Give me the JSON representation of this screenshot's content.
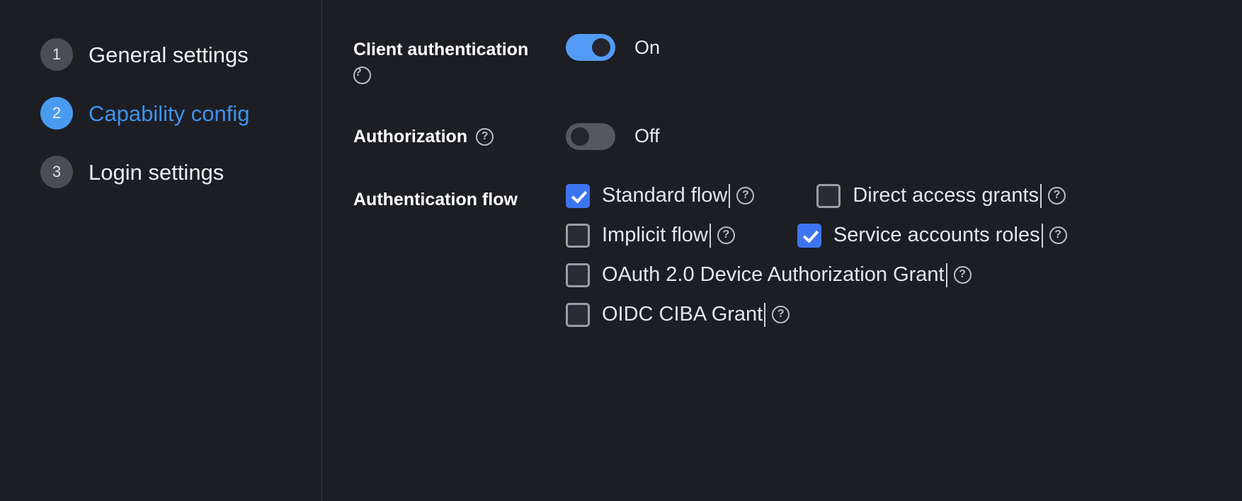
{
  "wizard": {
    "steps": [
      {
        "number": "1",
        "label": "General settings",
        "current": false
      },
      {
        "number": "2",
        "label": "Capability config",
        "current": true
      },
      {
        "number": "3",
        "label": "Login settings",
        "current": false
      }
    ]
  },
  "form": {
    "client_authentication": {
      "label": "Client authentication",
      "help": "?",
      "state_label": "On",
      "enabled": true
    },
    "authorization": {
      "label": "Authorization",
      "help": "?",
      "state_label": "Off",
      "enabled": false
    },
    "authentication_flow": {
      "label": "Authentication flow",
      "options": [
        {
          "label": "Standard flow",
          "checked": true,
          "help": "?"
        },
        {
          "label": "Direct access grants",
          "checked": false,
          "help": "?"
        },
        {
          "label": "Implicit flow",
          "checked": false,
          "help": "?"
        },
        {
          "label": "Service accounts roles",
          "checked": true,
          "help": "?"
        },
        {
          "label": "OAuth 2.0 Device Authorization Grant",
          "checked": false,
          "help": "?"
        },
        {
          "label": "OIDC CIBA Grant",
          "checked": false,
          "help": "?"
        }
      ]
    }
  },
  "colors": {
    "background": "#1c1e24",
    "accent_blue": "#4a9bf0",
    "checkbox_blue": "#3d74f0",
    "toggle_off": "#55585f",
    "divider": "#3a3d45",
    "text": "#e8e8e8"
  }
}
